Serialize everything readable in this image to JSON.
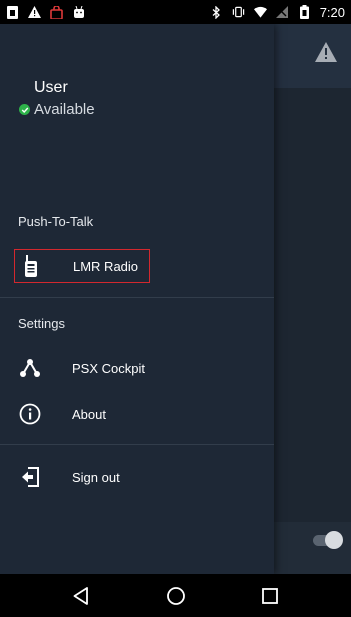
{
  "status_bar": {
    "time": "7:20",
    "left_icons": [
      "sim-icon",
      "warning-small-icon",
      "shopping-bag-icon",
      "android-icon"
    ],
    "right_icons": [
      "bluetooth-icon",
      "vibrate-icon",
      "wifi-icon",
      "signal-icon",
      "battery-icon"
    ]
  },
  "drawer": {
    "user": {
      "name": "User",
      "status": "Available",
      "status_color": "#2eb34a"
    },
    "sections": [
      {
        "header": "Push-To-Talk",
        "items": [
          {
            "label": "LMR Radio",
            "icon": "walkie-talkie-icon",
            "selected": true
          }
        ]
      },
      {
        "header": "Settings",
        "items": [
          {
            "label": "PSX Cockpit",
            "icon": "network-icon",
            "selected": false
          },
          {
            "label": "About",
            "icon": "info-icon",
            "selected": false
          }
        ]
      }
    ],
    "sign_out": {
      "label": "Sign out",
      "icon": "sign-out-icon"
    }
  },
  "background_app": {
    "warning_icon": "warning-icon",
    "toggle_on": true
  },
  "colors": {
    "drawer_bg": "#1e2836",
    "selection_border": "#d3282e",
    "app_bg": "#1d2631"
  },
  "nav_bar": {
    "buttons": [
      "back-icon",
      "home-icon",
      "recents-icon"
    ]
  }
}
